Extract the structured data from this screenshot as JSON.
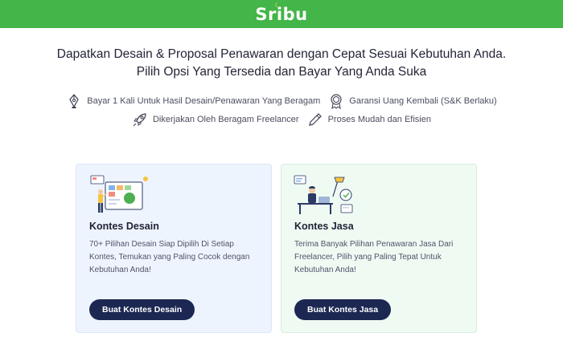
{
  "header": {
    "logo_text": "Sribu",
    "color": "#43b549"
  },
  "headline": "Dapatkan Desain & Proposal Penawaran dengan Cepat Sesuai Kebutuhan Anda. Pilih Opsi Yang Tersedia dan Bayar Yang Anda Suka",
  "features": [
    {
      "icon": "lightbulb-pen-icon",
      "label": "Bayar 1 Kali Untuk Hasil Desain/Penawaran Yang Beragam"
    },
    {
      "icon": "medal-icon",
      "label": "Garansi Uang Kembali (S&K Berlaku)"
    },
    {
      "icon": "rocket-icon",
      "label": "Dikerjakan Oleh Beragam Freelancer"
    },
    {
      "icon": "pencil-icon",
      "label": "Proses Mudah dan Efisien"
    }
  ],
  "cards": {
    "design": {
      "title": "Kontes Desain",
      "description": "70+ Pilihan Desain Siap Dipilih Di Setiap Kontes, Temukan yang Paling Cocok dengan Kebutuhan Anda!",
      "button": "Buat Kontes Desain"
    },
    "service": {
      "title": "Kontes Jasa",
      "description": "Terima Banyak Pilihan Penawaran Jasa Dari Freelancer, Pilih yang Paling Tepat Untuk Kebutuhan Anda!",
      "button": "Buat Kontes Jasa"
    }
  },
  "colors": {
    "brand_green": "#43b549",
    "button_navy": "#1c2852"
  }
}
